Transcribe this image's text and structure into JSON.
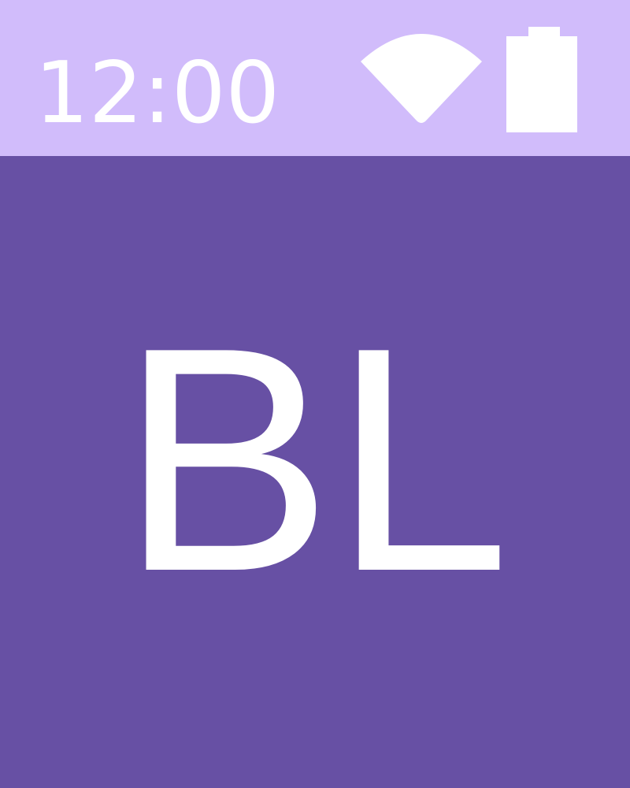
{
  "colors": {
    "status_bar_background": "#D1BCFB",
    "content_background": "#6750A4",
    "foreground": "#FFFFFF"
  },
  "status_bar": {
    "time": "12:00",
    "icons": [
      "wifi-icon",
      "battery-icon"
    ]
  },
  "avatar": {
    "initials": "BL"
  }
}
